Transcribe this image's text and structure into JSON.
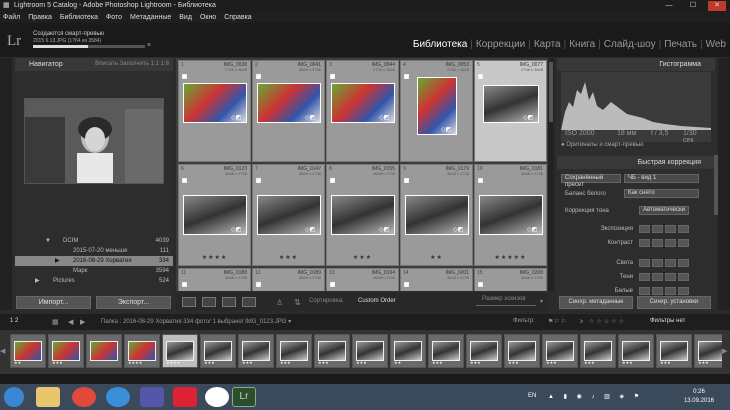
{
  "window": {
    "title": "Lightroom 5 Catalog - Adobe Photoshop Lightroom - Библиотека",
    "min": "—",
    "max": "☐",
    "close": "✕"
  },
  "menu": [
    "Файл",
    "Правка",
    "Библиотека",
    "Фото",
    "Метаданные",
    "Вид",
    "Окно",
    "Справка"
  ],
  "header": {
    "logo": "Lr",
    "progress_title": "Создаются смарт-превью",
    "progress_sub": "2015 6.13.JPG (1764 из 3584)",
    "progress_fraction": 0.49,
    "progress_close": "×"
  },
  "modules": [
    {
      "label": "Библиотека",
      "active": true
    },
    {
      "label": "Коррекции",
      "active": false
    },
    {
      "label": "Карта",
      "active": false
    },
    {
      "label": "Книга",
      "active": false
    },
    {
      "label": "Слайд-шоу",
      "active": false
    },
    {
      "label": "Печать",
      "active": false
    },
    {
      "label": "Web",
      "active": false
    }
  ],
  "navigator": {
    "title": "Навигатор",
    "opts": "Вписать  Заполнить  1:1  1:8"
  },
  "folders": [
    {
      "name": "DCIM",
      "count": "4039",
      "indent": 3,
      "selected": false,
      "arrow": "▼"
    },
    {
      "name": "2015-07-20 меньше",
      "count": "111",
      "indent": 4,
      "selected": false,
      "arrow": ""
    },
    {
      "name": "2016-08-29 Хорватия",
      "count": "334",
      "indent": 4,
      "selected": true,
      "arrow": "▶"
    },
    {
      "name": "Марк",
      "count": "3594",
      "indent": 4,
      "selected": false,
      "arrow": ""
    },
    {
      "name": "Pictures",
      "count": "524",
      "indent": 2,
      "selected": false,
      "arrow": "▶"
    }
  ],
  "left_buttons": {
    "import": "Импорт...",
    "export": "Экспорт..."
  },
  "grid_cells": [
    {
      "num": "1",
      "name": "IMG_0038",
      "dim": "2736 x 3648",
      "stars": "",
      "selected": false
    },
    {
      "num": "2",
      "name": "IMG_0041",
      "dim": "3648 x 2736",
      "stars": "",
      "selected": false
    },
    {
      "num": "3",
      "name": "IMG_0044",
      "dim": "2736 x 3648",
      "stars": "",
      "selected": false
    },
    {
      "num": "4",
      "name": "IMG_0053",
      "dim": "2736 x 3648",
      "stars": "",
      "selected": false
    },
    {
      "num": "5",
      "name": "IMG_0077",
      "dim": "2736 x 3648",
      "stars": "",
      "selected": true
    },
    {
      "num": "6",
      "name": "IMG_0123",
      "dim": "3648 x 2736",
      "stars": "★★★★",
      "selected": false
    },
    {
      "num": "7",
      "name": "IMG_0147",
      "dim": "3648 x 2736",
      "stars": "★★★",
      "selected": false
    },
    {
      "num": "8",
      "name": "IMG_0155",
      "dim": "3648 x 2736",
      "stars": "★★★",
      "selected": false
    },
    {
      "num": "9",
      "name": "IMG_0179",
      "dim": "3648 x 2736",
      "stars": "★★",
      "selected": false
    },
    {
      "num": "10",
      "name": "IMG_0181",
      "dim": "3648 x 2736",
      "stars": "★★★★★",
      "selected": false
    },
    {
      "num": "11",
      "name": "IMG_0188",
      "dim": "3648 x 2736",
      "stars": "★★★",
      "selected": false
    },
    {
      "num": "12",
      "name": "IMG_0189",
      "dim": "3648 x 2736",
      "stars": "★★★",
      "selected": false
    },
    {
      "num": "13",
      "name": "IMG_0194",
      "dim": "3648 x 2736",
      "stars": "★★★",
      "selected": false
    },
    {
      "num": "14",
      "name": "IMG_0201",
      "dim": "3648 x 2736",
      "stars": "★★",
      "selected": false
    },
    {
      "num": "15",
      "name": "IMG_0208",
      "dim": "3648 x 2736",
      "stars": "★★★★",
      "selected": false
    }
  ],
  "toolbar": {
    "sort_label": "Сортировка:",
    "sort_value": "Custom Order",
    "thumb_label": "Размер эскизов"
  },
  "right": {
    "histogram": "Гистограмма",
    "iso": "ISO 2000",
    "focal": "18 мм",
    "aperture": "f / 3,5",
    "shutter": "1/30 сек",
    "originals": "Оригиналы и смарт-превью",
    "quick": "Быстрая коррекция",
    "saved_preset": "Сохранённый пресет",
    "saved_preset_val": "ЧБ - вид 1",
    "wb": "Баланс белого",
    "wb_val": "Как снято",
    "tone": "Коррекция тона",
    "tone_btn": "Автоматически",
    "rows": [
      "Экспозиция",
      "Контраст",
      "Света",
      "Тени",
      "Белые"
    ],
    "sync_meta": "Синхр. метаданные",
    "sync_set": "Синхр. установки"
  },
  "filmbar": {
    "pages": "1   2",
    "path": "Папка : 2016-08-29 Хорватия  334 фото/ 1 выбрано/ IMG_0123.JPG ▾",
    "filter": "Фильтр:",
    "filter_val": "Фильтры нет"
  },
  "film": [
    {
      "stars": "★★",
      "selected": false
    },
    {
      "stars": "★★★",
      "selected": false
    },
    {
      "stars": "",
      "selected": false
    },
    {
      "stars": "★★★★",
      "selected": false
    },
    {
      "stars": "★★★★",
      "selected": true
    },
    {
      "stars": "★★★",
      "selected": false
    },
    {
      "stars": "★★★",
      "selected": false
    },
    {
      "stars": "★★★",
      "selected": false
    },
    {
      "stars": "★★★",
      "selected": false
    },
    {
      "stars": "★★★",
      "selected": false
    },
    {
      "stars": "★★",
      "selected": false
    },
    {
      "stars": "★★★",
      "selected": false
    },
    {
      "stars": "★★★",
      "selected": false
    },
    {
      "stars": "★★★",
      "selected": false
    },
    {
      "stars": "★★★",
      "selected": false
    },
    {
      "stars": "★★★",
      "selected": false
    },
    {
      "stars": "★★★",
      "selected": false
    },
    {
      "stars": "★★★",
      "selected": false
    },
    {
      "stars": "★★★",
      "selected": false
    }
  ],
  "taskbar": {
    "lang": "EN",
    "time": "0:26",
    "date": "13.09.2016",
    "lr": "Lr",
    "colors": {
      "start": "#3a87d5",
      "explorer": "#e9c56b",
      "chrome": "#e14a3a",
      "ie": "#3b8fd8",
      "media": "#55a",
      "yandex": "#ffffff",
      "lr": "#2d4d2d"
    }
  }
}
